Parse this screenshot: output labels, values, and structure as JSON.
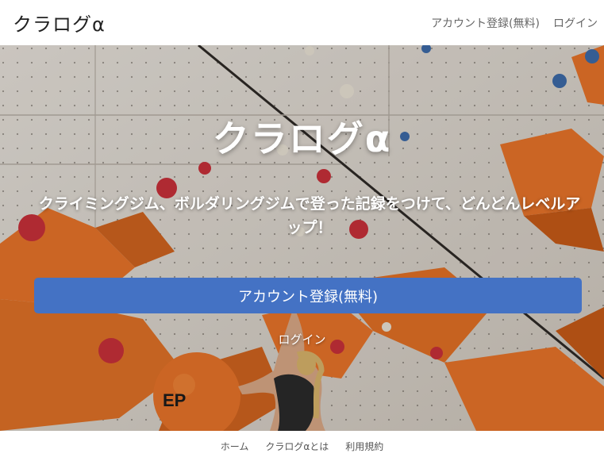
{
  "navbar": {
    "brand": "クラログα",
    "links": [
      {
        "label": "アカウント登録(無料)"
      },
      {
        "label": "ログイン"
      }
    ]
  },
  "hero": {
    "title": "クラログα",
    "tagline": "クライミングジム、ボルダリングジムで登った記録をつけて、どんどんレベルアップ！",
    "cta_label": "アカウント登録(無料)",
    "login_label": "ログイン"
  },
  "footer": {
    "links": [
      {
        "label": "ホーム"
      },
      {
        "label": "クラログαとは"
      },
      {
        "label": "利用規約"
      }
    ]
  },
  "colors": {
    "accent": "#4472c4",
    "hold_orange": "#e8742a",
    "wall": "#d8d2ca"
  }
}
